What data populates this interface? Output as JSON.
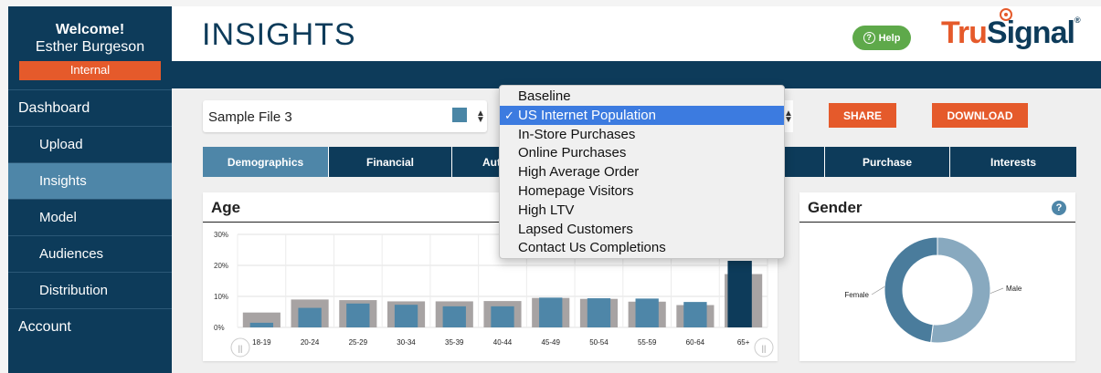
{
  "sidebar": {
    "welcome": "Welcome!",
    "user_name": "Esther Burgeson",
    "role": "Internal",
    "nav": [
      {
        "label": "Dashboard",
        "level": "top",
        "active": false
      },
      {
        "label": "Upload",
        "level": "sub",
        "active": false
      },
      {
        "label": "Insights",
        "level": "sub",
        "active": true
      },
      {
        "label": "Model",
        "level": "sub",
        "active": false
      },
      {
        "label": "Audiences",
        "level": "sub",
        "active": false
      },
      {
        "label": "Distribution",
        "level": "sub",
        "active": false
      },
      {
        "label": "Account",
        "level": "top",
        "active": false
      }
    ]
  },
  "header": {
    "title": "INSIGHTS",
    "help_label": "Help",
    "logo_part1": "Tru",
    "logo_part2": "Signal",
    "logo_mark": "®"
  },
  "controls": {
    "file_value": "Sample File 3",
    "share_label": "SHARE",
    "download_label": "DOWNLOAD"
  },
  "compare_dropdown": {
    "options": [
      "Baseline",
      "US Internet Population",
      "In-Store Purchases",
      "Online Purchases",
      "High Average Order",
      "Homepage Visitors",
      "High LTV",
      "Lapsed Customers",
      "Contact Us Completions"
    ],
    "selected_index": 1
  },
  "tabs": [
    "Demographics",
    "Financial",
    "Auto",
    "Purchase",
    "Interests"
  ],
  "active_tab": "Demographics",
  "age_panel": {
    "title": "Age"
  },
  "gender_panel": {
    "title": "Gender",
    "help_icon": "?"
  },
  "colors": {
    "navy": "#0d3b5a",
    "accent_blue": "#4e86a8",
    "orange": "#e55a2b",
    "green": "#5ea94a",
    "gray_bar": "#a7a3a3"
  },
  "chart_data": [
    {
      "type": "bar",
      "title": "Age",
      "categories": [
        "18-19",
        "20-24",
        "25-29",
        "30-34",
        "35-39",
        "40-44",
        "45-49",
        "50-54",
        "55-59",
        "60-64",
        "65+"
      ],
      "y_ticks": [
        "0%",
        "10%",
        "20%",
        "30%"
      ],
      "ylim": [
        0,
        30
      ],
      "series": [
        {
          "values": [
            4.8,
            9.0,
            8.8,
            8.4,
            8.4,
            8.5,
            9.5,
            9.2,
            8.3,
            7.2,
            17.2
          ],
          "color": "#a7a3a3"
        },
        {
          "values": [
            1.5,
            6.3,
            7.7,
            7.3,
            6.8,
            6.8,
            9.6,
            9.4,
            9.3,
            8.2,
            22.5
          ],
          "color": "#4e86a8"
        }
      ]
    },
    {
      "type": "pie",
      "title": "Gender",
      "categories": [
        "Male",
        "Female"
      ],
      "values": [
        52,
        48
      ],
      "colors": [
        "#88a9bf",
        "#4a7c9c"
      ]
    }
  ]
}
